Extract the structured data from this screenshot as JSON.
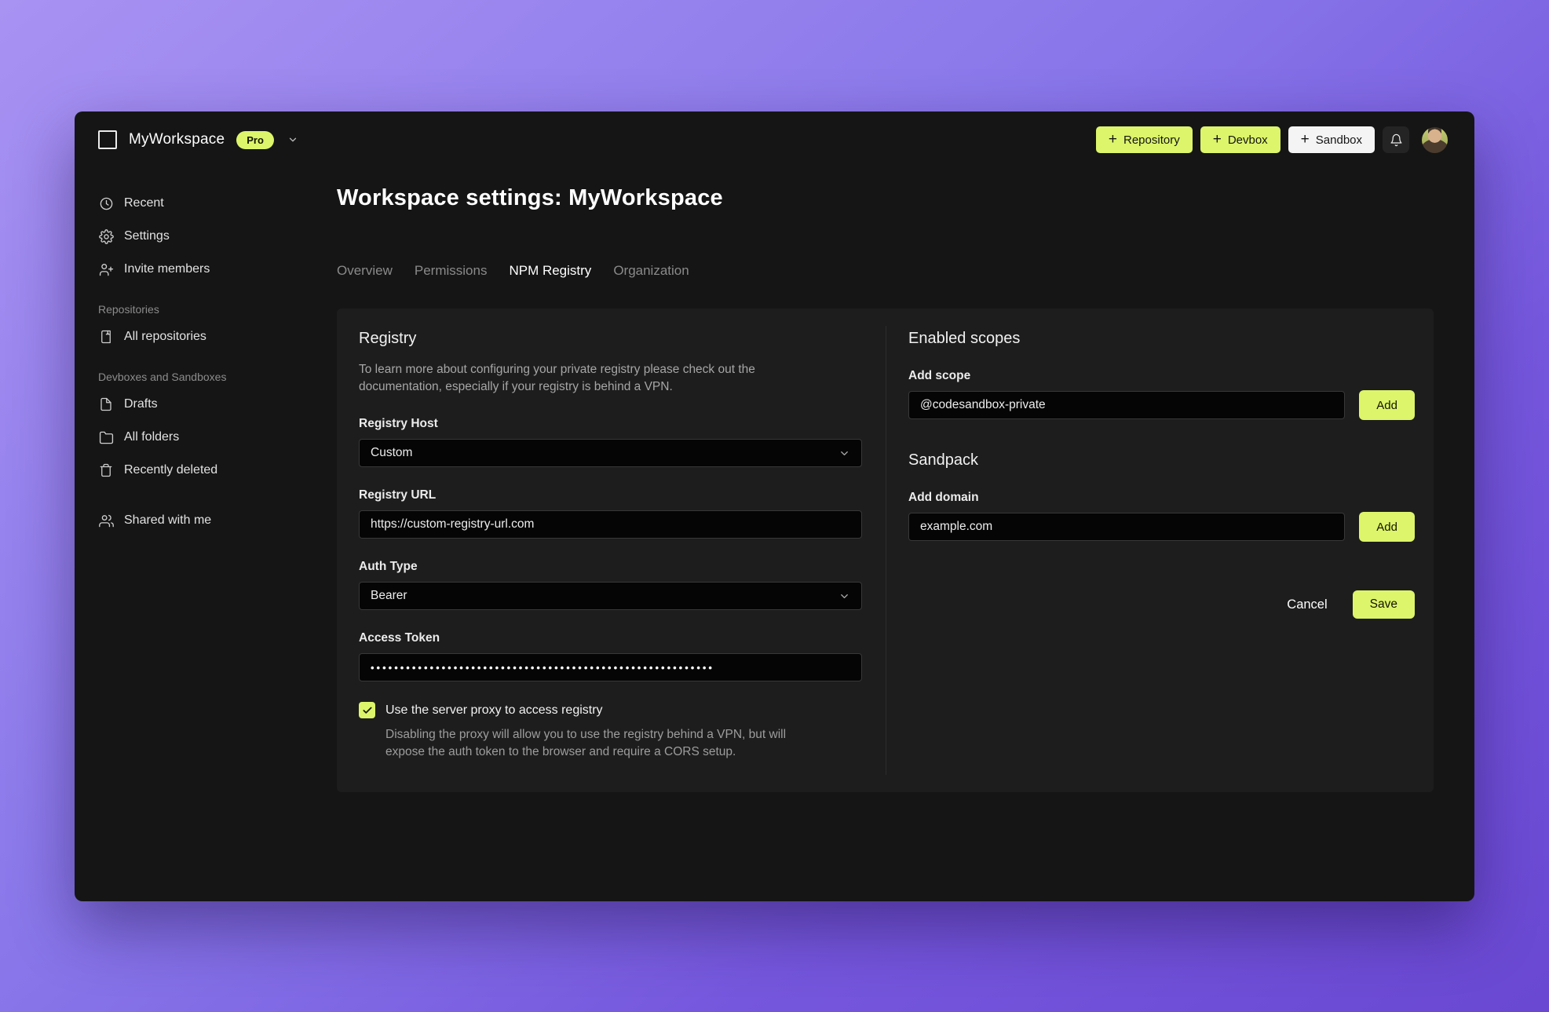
{
  "colors": {
    "accent": "#dcf56a",
    "window_bg": "#151515",
    "panel_bg": "#1d1d1d",
    "input_bg": "#050505",
    "background_purple": "#8977ea"
  },
  "header": {
    "workspace_name": "MyWorkspace",
    "plan_badge": "Pro",
    "buttons": [
      {
        "label": "Repository",
        "style": "accent"
      },
      {
        "label": "Devbox",
        "style": "accent"
      },
      {
        "label": "Sandbox",
        "style": "white"
      }
    ]
  },
  "sidebar": {
    "primary": [
      {
        "icon": "clock-icon",
        "label": "Recent"
      },
      {
        "icon": "gear-icon",
        "label": "Settings"
      },
      {
        "icon": "user-plus-icon",
        "label": "Invite members"
      }
    ],
    "sections": [
      {
        "label": "Repositories",
        "items": [
          {
            "icon": "repo-icon",
            "label": "All repositories"
          }
        ]
      },
      {
        "label": "Devboxes and Sandboxes",
        "items": [
          {
            "icon": "file-icon",
            "label": "Drafts"
          },
          {
            "icon": "folder-icon",
            "label": "All folders"
          },
          {
            "icon": "trash-icon",
            "label": "Recently deleted"
          }
        ]
      }
    ],
    "secondary": [
      {
        "icon": "users-icon",
        "label": "Shared with me"
      }
    ]
  },
  "page": {
    "title": "Workspace settings: MyWorkspace",
    "tabs": [
      {
        "label": "Overview",
        "active": false
      },
      {
        "label": "Permissions",
        "active": false
      },
      {
        "label": "NPM Registry",
        "active": true
      },
      {
        "label": "Organization",
        "active": false
      }
    ]
  },
  "registry": {
    "heading": "Registry",
    "description": "To learn more about configuring your private registry please check out the documentation, especially if your registry is behind a VPN.",
    "fields": {
      "registry_host": {
        "label": "Registry Host",
        "value": "Custom"
      },
      "registry_url": {
        "label": "Registry URL",
        "value": "https://custom-registry-url.com"
      },
      "auth_type": {
        "label": "Auth Type",
        "value": "Bearer"
      },
      "access_token": {
        "label": "Access Token",
        "masked_value": "••••••••••••••••••••••••••••••••••••••••••••••••••••••••••"
      }
    },
    "proxy": {
      "checked": true,
      "label": "Use the server proxy to access registry",
      "description": "Disabling the proxy will allow you to use the registry behind a VPN, but will expose the auth token to the browser and require a CORS setup."
    }
  },
  "scopes": {
    "heading": "Enabled scopes",
    "add_scope_label": "Add scope",
    "input_value": "@codesandbox-private",
    "add_button": "Add"
  },
  "sandpack": {
    "heading": "Sandpack",
    "add_domain_label": "Add domain",
    "input_value": "example.com",
    "add_button": "Add"
  },
  "footer": {
    "cancel": "Cancel",
    "save": "Save"
  }
}
